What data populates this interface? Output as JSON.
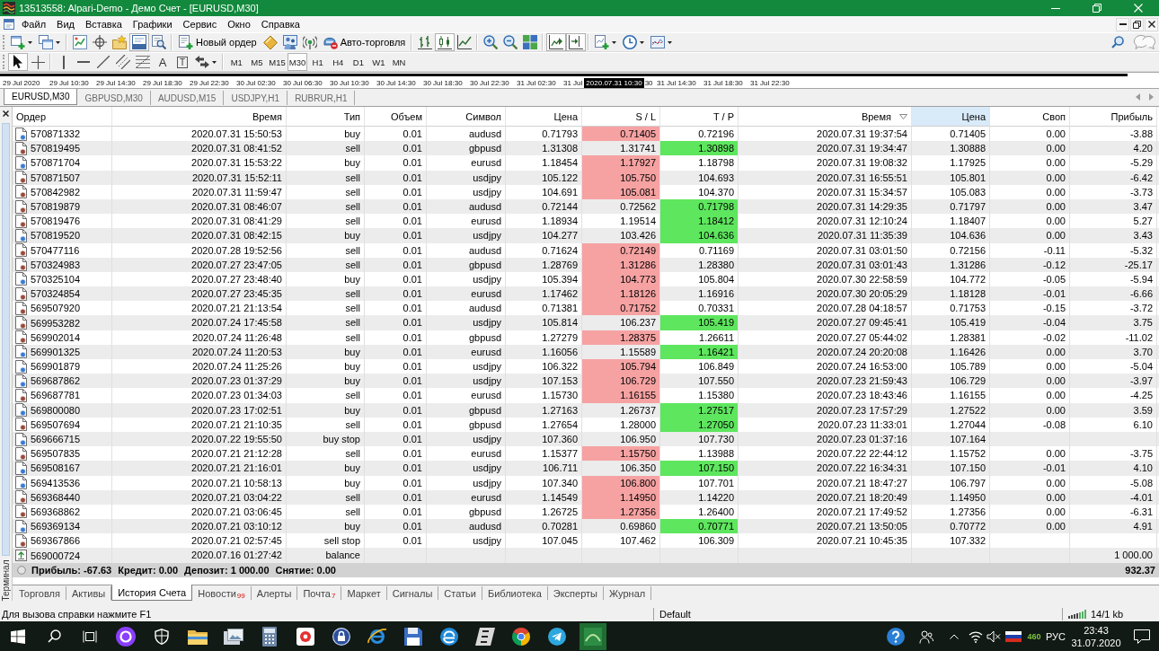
{
  "window": {
    "title": "13513558: Alpari-Demo - Демо Счет - [EURUSD,M30]"
  },
  "menu": [
    "Файл",
    "Вид",
    "Вставка",
    "Графики",
    "Сервис",
    "Окно",
    "Справка"
  ],
  "main_toolbar": {
    "tools": [
      {
        "pressed": false
      },
      {
        "pressed": false
      },
      {
        "pressed": false
      },
      {
        "pressed": false
      },
      {
        "pressed": false
      },
      {
        "pressed": true
      },
      {
        "pressed": false
      },
      {
        "label": "Новый ордер",
        "pressed": false
      },
      {
        "pressed": false
      },
      {
        "pressed": false
      },
      {
        "pressed": false
      },
      {
        "label": "Авто-торговля",
        "pressed": false
      },
      {
        "pressed": false
      },
      {
        "pressed": true
      },
      {
        "pressed": false
      },
      {
        "pressed": false
      },
      {
        "pressed": false
      },
      {
        "pressed": false
      },
      {
        "pressed": true
      },
      {
        "pressed": true
      },
      {
        "pressed": false
      },
      {
        "pressed": false
      },
      {
        "pressed": false
      }
    ]
  },
  "drawing_toolbar": {
    "tools": [
      {
        "pressed": true
      },
      {
        "pressed": false
      },
      {
        "pressed": false
      },
      {
        "pressed": false
      },
      {
        "pressed": false
      },
      {
        "pressed": false
      },
      {
        "pressed": false
      },
      {
        "glyph": "A",
        "pressed": false
      },
      {
        "glyph": "T",
        "pressed": false
      },
      {
        "pressed": false
      }
    ],
    "timeframes": [
      {
        "label": "M1",
        "selected": false
      },
      {
        "label": "M5",
        "selected": false
      },
      {
        "label": "M15",
        "selected": false
      },
      {
        "label": "M30",
        "selected": true
      },
      {
        "label": "H1",
        "selected": false
      },
      {
        "label": "H4",
        "selected": false
      },
      {
        "label": "D1",
        "selected": false
      },
      {
        "label": "W1",
        "selected": false
      },
      {
        "label": "MN",
        "selected": false
      }
    ]
  },
  "timeline": {
    "items": [
      {
        "kind": "label",
        "text": "29 Jul 2020"
      },
      {
        "kind": "label",
        "text": "29 Jul 10:30"
      },
      {
        "kind": "label",
        "text": "29 Jul 14:30"
      },
      {
        "kind": "label",
        "text": "29 Jul 18:30"
      },
      {
        "kind": "label",
        "text": "29 Jul 22:30"
      },
      {
        "kind": "label",
        "text": "30 Jul 02:30"
      },
      {
        "kind": "label",
        "text": "30 Jul 06:30"
      },
      {
        "kind": "label",
        "text": "30 Jul 10:30"
      },
      {
        "kind": "label",
        "text": "30 Jul 14:30"
      },
      {
        "kind": "label",
        "text": "30 Jul 18:30"
      },
      {
        "kind": "label",
        "text": "30 Jul 22:30"
      },
      {
        "kind": "label",
        "text": "31 Jul 02:30"
      },
      {
        "kind": "label",
        "text": "31 Jul"
      },
      {
        "kind": "cursor",
        "text": "2020.07.31 10:30"
      },
      {
        "kind": "label",
        "text": "30"
      },
      {
        "kind": "label",
        "text": "31 Jul 14:30"
      },
      {
        "kind": "label",
        "text": "31 Jul 18:30"
      },
      {
        "kind": "label",
        "text": "31 Jul 22:30"
      }
    ]
  },
  "chart_tabs": [
    {
      "label": "EURUSD,M30",
      "selected": true
    },
    {
      "label": "GBPUSD,M30",
      "selected": false
    },
    {
      "label": "AUDUSD,M15",
      "selected": false
    },
    {
      "label": "USDJPY,H1",
      "selected": false
    },
    {
      "label": "RUBRUR,H1",
      "selected": false
    }
  ],
  "terminal": {
    "title": "Терминал",
    "table": {
      "columns": [
        {
          "label": "Ордер",
          "sorted": false,
          "hovered": false
        },
        {
          "label": "Время",
          "sorted": false,
          "hovered": false
        },
        {
          "label": "Тип",
          "sorted": false,
          "hovered": false
        },
        {
          "label": "Объем",
          "sorted": false,
          "hovered": false
        },
        {
          "label": "Символ",
          "sorted": false,
          "hovered": false
        },
        {
          "label": "Цена",
          "sorted": false,
          "hovered": false
        },
        {
          "label": "S / L",
          "sorted": false,
          "hovered": false
        },
        {
          "label": "T / P",
          "sorted": false,
          "hovered": false
        },
        {
          "label": "Время",
          "sorted": true,
          "hovered": false
        },
        {
          "label": "Цена",
          "sorted": false,
          "hovered": true
        },
        {
          "label": "Своп",
          "sorted": false,
          "hovered": false
        },
        {
          "label": "Прибыль",
          "sorted": false,
          "hovered": false
        }
      ],
      "rows": [
        {
          "kind": "buy",
          "order": "570871332",
          "open_time": "2020.07.31 15:50:53",
          "type": "buy",
          "volume": "0.01",
          "symbol": "audusd",
          "open_price": "0.71793",
          "sl": "0.71405",
          "tp": "0.72196",
          "close_time": "2020.07.31 19:37:54",
          "close_price": "0.71405",
          "swap": "0.00",
          "profit": "-3.88",
          "sl_hit": true,
          "tp_hit": false
        },
        {
          "kind": "sell",
          "order": "570819495",
          "open_time": "2020.07.31 08:41:52",
          "type": "sell",
          "volume": "0.01",
          "symbol": "gbpusd",
          "open_price": "1.31308",
          "sl": "1.31741",
          "tp": "1.30898",
          "close_time": "2020.07.31 19:34:47",
          "close_price": "1.30888",
          "swap": "0.00",
          "profit": "4.20",
          "sl_hit": false,
          "tp_hit": true
        },
        {
          "kind": "buy",
          "order": "570871704",
          "open_time": "2020.07.31 15:53:22",
          "type": "buy",
          "volume": "0.01",
          "symbol": "eurusd",
          "open_price": "1.18454",
          "sl": "1.17927",
          "tp": "1.18798",
          "close_time": "2020.07.31 19:08:32",
          "close_price": "1.17925",
          "swap": "0.00",
          "profit": "-5.29",
          "sl_hit": true,
          "tp_hit": false
        },
        {
          "kind": "sell",
          "order": "570871507",
          "open_time": "2020.07.31 15:52:11",
          "type": "sell",
          "volume": "0.01",
          "symbol": "usdjpy",
          "open_price": "105.122",
          "sl": "105.750",
          "tp": "104.693",
          "close_time": "2020.07.31 16:55:51",
          "close_price": "105.801",
          "swap": "0.00",
          "profit": "-6.42",
          "sl_hit": true,
          "tp_hit": false
        },
        {
          "kind": "sell",
          "order": "570842982",
          "open_time": "2020.07.31 11:59:47",
          "type": "sell",
          "volume": "0.01",
          "symbol": "usdjpy",
          "open_price": "104.691",
          "sl": "105.081",
          "tp": "104.370",
          "close_time": "2020.07.31 15:34:57",
          "close_price": "105.083",
          "swap": "0.00",
          "profit": "-3.73",
          "sl_hit": true,
          "tp_hit": false
        },
        {
          "kind": "sell",
          "order": "570819879",
          "open_time": "2020.07.31 08:46:07",
          "type": "sell",
          "volume": "0.01",
          "symbol": "audusd",
          "open_price": "0.72144",
          "sl": "0.72562",
          "tp": "0.71798",
          "close_time": "2020.07.31 14:29:35",
          "close_price": "0.71797",
          "swap": "0.00",
          "profit": "3.47",
          "sl_hit": false,
          "tp_hit": true
        },
        {
          "kind": "sell",
          "order": "570819476",
          "open_time": "2020.07.31 08:41:29",
          "type": "sell",
          "volume": "0.01",
          "symbol": "eurusd",
          "open_price": "1.18934",
          "sl": "1.19514",
          "tp": "1.18412",
          "close_time": "2020.07.31 12:10:24",
          "close_price": "1.18407",
          "swap": "0.00",
          "profit": "5.27",
          "sl_hit": false,
          "tp_hit": true
        },
        {
          "kind": "buy",
          "order": "570819520",
          "open_time": "2020.07.31 08:42:15",
          "type": "buy",
          "volume": "0.01",
          "symbol": "usdjpy",
          "open_price": "104.277",
          "sl": "103.426",
          "tp": "104.636",
          "close_time": "2020.07.31 11:35:39",
          "close_price": "104.636",
          "swap": "0.00",
          "profit": "3.43",
          "sl_hit": false,
          "tp_hit": true
        },
        {
          "kind": "sell",
          "order": "570477116",
          "open_time": "2020.07.28 19:52:56",
          "type": "sell",
          "volume": "0.01",
          "symbol": "audusd",
          "open_price": "0.71624",
          "sl": "0.72149",
          "tp": "0.71169",
          "close_time": "2020.07.31 03:01:50",
          "close_price": "0.72156",
          "swap": "-0.11",
          "profit": "-5.32",
          "sl_hit": true,
          "tp_hit": false
        },
        {
          "kind": "sell",
          "order": "570324983",
          "open_time": "2020.07.27 23:47:05",
          "type": "sell",
          "volume": "0.01",
          "symbol": "gbpusd",
          "open_price": "1.28769",
          "sl": "1.31286",
          "tp": "1.28380",
          "close_time": "2020.07.31 03:01:43",
          "close_price": "1.31286",
          "swap": "-0.12",
          "profit": "-25.17",
          "sl_hit": true,
          "tp_hit": false
        },
        {
          "kind": "buy",
          "order": "570325104",
          "open_time": "2020.07.27 23:48:40",
          "type": "buy",
          "volume": "0.01",
          "symbol": "usdjpy",
          "open_price": "105.394",
          "sl": "104.773",
          "tp": "105.804",
          "close_time": "2020.07.30 22:58:59",
          "close_price": "104.772",
          "swap": "-0.05",
          "profit": "-5.94",
          "sl_hit": true,
          "tp_hit": false
        },
        {
          "kind": "sell",
          "order": "570324854",
          "open_time": "2020.07.27 23:45:35",
          "type": "sell",
          "volume": "0.01",
          "symbol": "eurusd",
          "open_price": "1.17462",
          "sl": "1.18126",
          "tp": "1.16916",
          "close_time": "2020.07.30 20:05:29",
          "close_price": "1.18128",
          "swap": "-0.01",
          "profit": "-6.66",
          "sl_hit": true,
          "tp_hit": false
        },
        {
          "kind": "sell",
          "order": "569507920",
          "open_time": "2020.07.21 21:13:54",
          "type": "sell",
          "volume": "0.01",
          "symbol": "audusd",
          "open_price": "0.71381",
          "sl": "0.71752",
          "tp": "0.70331",
          "close_time": "2020.07.28 04:18:57",
          "close_price": "0.71753",
          "swap": "-0.15",
          "profit": "-3.72",
          "sl_hit": true,
          "tp_hit": false
        },
        {
          "kind": "sell",
          "order": "569953282",
          "open_time": "2020.07.24 17:45:58",
          "type": "sell",
          "volume": "0.01",
          "symbol": "usdjpy",
          "open_price": "105.814",
          "sl": "106.237",
          "tp": "105.419",
          "close_time": "2020.07.27 09:45:41",
          "close_price": "105.419",
          "swap": "-0.04",
          "profit": "3.75",
          "sl_hit": false,
          "tp_hit": true
        },
        {
          "kind": "sell",
          "order": "569902014",
          "open_time": "2020.07.24 11:26:48",
          "type": "sell",
          "volume": "0.01",
          "symbol": "gbpusd",
          "open_price": "1.27279",
          "sl": "1.28375",
          "tp": "1.26611",
          "close_time": "2020.07.27 05:44:02",
          "close_price": "1.28381",
          "swap": "-0.02",
          "profit": "-11.02",
          "sl_hit": true,
          "tp_hit": false
        },
        {
          "kind": "buy",
          "order": "569901325",
          "open_time": "2020.07.24 11:20:53",
          "type": "buy",
          "volume": "0.01",
          "symbol": "eurusd",
          "open_price": "1.16056",
          "sl": "1.15589",
          "tp": "1.16421",
          "close_time": "2020.07.24 20:20:08",
          "close_price": "1.16426",
          "swap": "0.00",
          "profit": "3.70",
          "sl_hit": false,
          "tp_hit": true
        },
        {
          "kind": "buy",
          "order": "569901879",
          "open_time": "2020.07.24 11:25:26",
          "type": "buy",
          "volume": "0.01",
          "symbol": "usdjpy",
          "open_price": "106.322",
          "sl": "105.794",
          "tp": "106.849",
          "close_time": "2020.07.24 16:53:00",
          "close_price": "105.789",
          "swap": "0.00",
          "profit": "-5.04",
          "sl_hit": true,
          "tp_hit": false
        },
        {
          "kind": "buy",
          "order": "569687862",
          "open_time": "2020.07.23 01:37:29",
          "type": "buy",
          "volume": "0.01",
          "symbol": "usdjpy",
          "open_price": "107.153",
          "sl": "106.729",
          "tp": "107.550",
          "close_time": "2020.07.23 21:59:43",
          "close_price": "106.729",
          "swap": "0.00",
          "profit": "-3.97",
          "sl_hit": true,
          "tp_hit": false
        },
        {
          "kind": "sell",
          "order": "569687781",
          "open_time": "2020.07.23 01:34:03",
          "type": "sell",
          "volume": "0.01",
          "symbol": "eurusd",
          "open_price": "1.15730",
          "sl": "1.16155",
          "tp": "1.15380",
          "close_time": "2020.07.23 18:43:46",
          "close_price": "1.16155",
          "swap": "0.00",
          "profit": "-4.25",
          "sl_hit": true,
          "tp_hit": false
        },
        {
          "kind": "buy",
          "order": "569800080",
          "open_time": "2020.07.23 17:02:51",
          "type": "buy",
          "volume": "0.01",
          "symbol": "gbpusd",
          "open_price": "1.27163",
          "sl": "1.26737",
          "tp": "1.27517",
          "close_time": "2020.07.23 17:57:29",
          "close_price": "1.27522",
          "swap": "0.00",
          "profit": "3.59",
          "sl_hit": false,
          "tp_hit": true
        },
        {
          "kind": "sell",
          "order": "569507694",
          "open_time": "2020.07.21 21:10:35",
          "type": "sell",
          "volume": "0.01",
          "symbol": "gbpusd",
          "open_price": "1.27654",
          "sl": "1.28000",
          "tp": "1.27050",
          "close_time": "2020.07.23 11:33:01",
          "close_price": "1.27044",
          "swap": "-0.08",
          "profit": "6.10",
          "sl_hit": false,
          "tp_hit": true
        },
        {
          "kind": "buy",
          "order": "569666715",
          "open_time": "2020.07.22 19:55:50",
          "type": "buy stop",
          "volume": "0.01",
          "symbol": "usdjpy",
          "open_price": "107.360",
          "sl": "106.950",
          "tp": "107.730",
          "close_time": "2020.07.23 01:37:16",
          "close_price": "107.164",
          "sl_hit": false,
          "tp_hit": false
        },
        {
          "kind": "sell",
          "order": "569507835",
          "open_time": "2020.07.21 21:12:28",
          "type": "sell",
          "volume": "0.01",
          "symbol": "eurusd",
          "open_price": "1.15377",
          "sl": "1.15750",
          "tp": "1.13988",
          "close_time": "2020.07.22 22:44:12",
          "close_price": "1.15752",
          "swap": "0.00",
          "profit": "-3.75",
          "sl_hit": true,
          "tp_hit": false
        },
        {
          "kind": "buy",
          "order": "569508167",
          "open_time": "2020.07.21 21:16:01",
          "type": "buy",
          "volume": "0.01",
          "symbol": "usdjpy",
          "open_price": "106.711",
          "sl": "106.350",
          "tp": "107.150",
          "close_time": "2020.07.22 16:34:31",
          "close_price": "107.150",
          "swap": "-0.01",
          "profit": "4.10",
          "sl_hit": false,
          "tp_hit": true
        },
        {
          "kind": "buy",
          "order": "569413536",
          "open_time": "2020.07.21 10:58:13",
          "type": "buy",
          "volume": "0.01",
          "symbol": "usdjpy",
          "open_price": "107.340",
          "sl": "106.800",
          "tp": "107.701",
          "close_time": "2020.07.21 18:47:27",
          "close_price": "106.797",
          "swap": "0.00",
          "profit": "-5.08",
          "sl_hit": true,
          "tp_hit": false
        },
        {
          "kind": "sell",
          "order": "569368440",
          "open_time": "2020.07.21 03:04:22",
          "type": "sell",
          "volume": "0.01",
          "symbol": "eurusd",
          "open_price": "1.14549",
          "sl": "1.14950",
          "tp": "1.14220",
          "close_time": "2020.07.21 18:20:49",
          "close_price": "1.14950",
          "swap": "0.00",
          "profit": "-4.01",
          "sl_hit": true,
          "tp_hit": false
        },
        {
          "kind": "sell",
          "order": "569368862",
          "open_time": "2020.07.21 03:06:45",
          "type": "sell",
          "volume": "0.01",
          "symbol": "gbpusd",
          "open_price": "1.26725",
          "sl": "1.27356",
          "tp": "1.26400",
          "close_time": "2020.07.21 17:49:52",
          "close_price": "1.27356",
          "swap": "0.00",
          "profit": "-6.31",
          "sl_hit": true,
          "tp_hit": false
        },
        {
          "kind": "buy",
          "order": "569369134",
          "open_time": "2020.07.21 03:10:12",
          "type": "buy",
          "volume": "0.01",
          "symbol": "audusd",
          "open_price": "0.70281",
          "sl": "0.69860",
          "tp": "0.70771",
          "close_time": "2020.07.21 13:50:05",
          "close_price": "0.70772",
          "swap": "0.00",
          "profit": "4.91",
          "sl_hit": false,
          "tp_hit": true
        },
        {
          "kind": "sell",
          "order": "569367866",
          "open_time": "2020.07.21 02:57:45",
          "type": "sell stop",
          "volume": "0.01",
          "symbol": "usdjpy",
          "open_price": "107.045",
          "sl": "107.462",
          "tp": "106.309",
          "close_time": "2020.07.21 10:45:35",
          "close_price": "107.332",
          "sl_hit": false,
          "tp_hit": false
        },
        {
          "kind": "balance",
          "order": "569000724",
          "open_time": "2020.07.16 01:27:42",
          "type": "balance",
          "profit": "1 000.00"
        }
      ]
    },
    "summary": {
      "items": [
        "Прибыль: -67.63",
        "Кредит: 0.00",
        "Депозит: 1 000.00",
        "Снятие: 0.00"
      ],
      "total": "932.37"
    },
    "tabs": [
      {
        "label": "Торговля",
        "selected": false
      },
      {
        "label": "Активы",
        "selected": false
      },
      {
        "label": "История Счета",
        "selected": true
      },
      {
        "label": "Новости",
        "badge": "99",
        "selected": false
      },
      {
        "label": "Алерты",
        "selected": false
      },
      {
        "label": "Почта",
        "badge": "7",
        "selected": false
      },
      {
        "label": "Маркет",
        "selected": false
      },
      {
        "label": "Сигналы",
        "selected": false
      },
      {
        "label": "Статьи",
        "selected": false
      },
      {
        "label": "Библиотека",
        "selected": false
      },
      {
        "label": "Эксперты",
        "selected": false
      },
      {
        "label": "Журнал",
        "selected": false
      }
    ]
  },
  "status_bar": {
    "help": "Для вызова справки нажмите F1",
    "profile": "Default",
    "traffic": "14/1 kb"
  },
  "taskbar": {
    "tray_count": "460",
    "language": "РУС",
    "time": "23:43",
    "date": "31.07.2020"
  }
}
